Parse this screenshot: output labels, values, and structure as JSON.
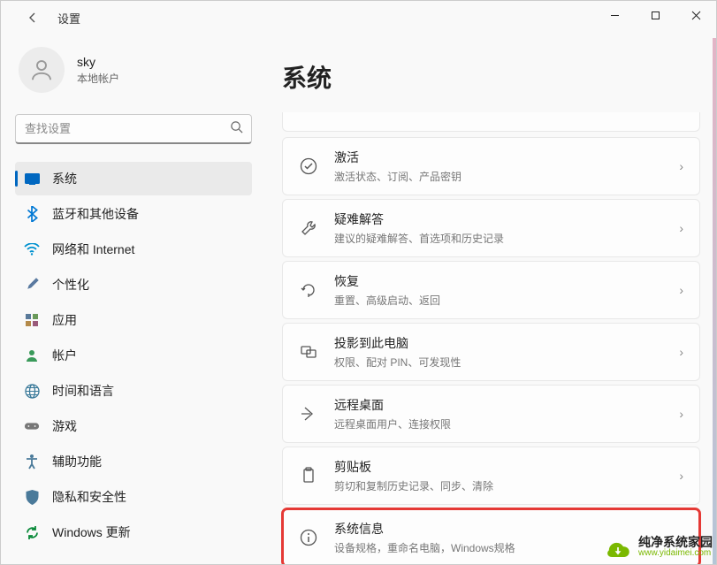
{
  "titlebar": {
    "title": "设置"
  },
  "user": {
    "name": "sky",
    "sub": "本地帐户"
  },
  "search": {
    "placeholder": "查找设置"
  },
  "nav": {
    "items": [
      {
        "label": "系统",
        "icon": "system"
      },
      {
        "label": "蓝牙和其他设备",
        "icon": "bluetooth"
      },
      {
        "label": "网络和 Internet",
        "icon": "wifi"
      },
      {
        "label": "个性化",
        "icon": "brush"
      },
      {
        "label": "应用",
        "icon": "apps"
      },
      {
        "label": "帐户",
        "icon": "account"
      },
      {
        "label": "时间和语言",
        "icon": "globe"
      },
      {
        "label": "游戏",
        "icon": "gamepad"
      },
      {
        "label": "辅助功能",
        "icon": "accessibility"
      },
      {
        "label": "隐私和安全性",
        "icon": "shield"
      },
      {
        "label": "Windows 更新",
        "icon": "update"
      }
    ]
  },
  "page": {
    "title": "系统"
  },
  "cards": [
    {
      "title": "激活",
      "sub": "激活状态、订阅、产品密钥",
      "icon": "check-circle"
    },
    {
      "title": "疑难解答",
      "sub": "建议的疑难解答、首选项和历史记录",
      "icon": "wrench"
    },
    {
      "title": "恢复",
      "sub": "重置、高级启动、返回",
      "icon": "recovery"
    },
    {
      "title": "投影到此电脑",
      "sub": "权限、配对 PIN、可发现性",
      "icon": "project"
    },
    {
      "title": "远程桌面",
      "sub": "远程桌面用户、连接权限",
      "icon": "remote"
    },
    {
      "title": "剪贴板",
      "sub": "剪切和复制历史记录、同步、清除",
      "icon": "clipboard"
    },
    {
      "title": "系统信息",
      "sub": "设备规格，重命名电脑，Windows规格",
      "icon": "info"
    }
  ],
  "watermark": {
    "title": "纯净系统家园",
    "sub": "www.yidaimei.com"
  }
}
